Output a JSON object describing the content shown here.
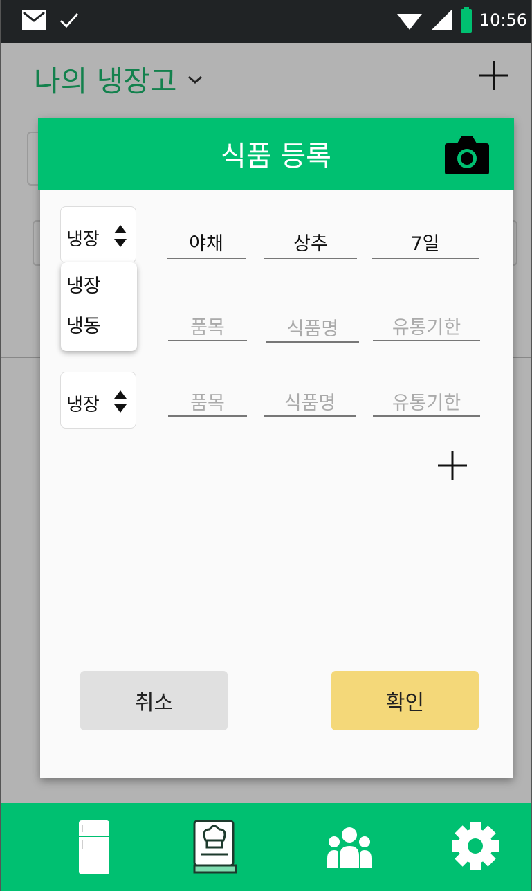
{
  "status_bar": {
    "time": "10:56",
    "icons": [
      "mail-icon",
      "check-icon",
      "wifi-icon",
      "signal-icon",
      "battery-icon"
    ]
  },
  "app": {
    "title": "나의 냉장고",
    "title_color": "#13814d"
  },
  "dialog": {
    "title": "식품 등록",
    "header_color": "#00c071",
    "rows": [
      {
        "storage": "냉장",
        "category": "야채",
        "name": "상추",
        "expiry": "7일"
      },
      {
        "storage": "",
        "category_placeholder": "품목",
        "name_placeholder": "식품명",
        "expiry_placeholder": "유통기한"
      },
      {
        "storage": "냉장",
        "category_placeholder": "품목",
        "name_placeholder": "식품명",
        "expiry_placeholder": "유통기한"
      }
    ],
    "dropdown_options": [
      "냉장",
      "냉동"
    ],
    "cancel_label": "취소",
    "confirm_label": "확인",
    "cancel_color": "#e0e0e0",
    "confirm_color": "#f4d879"
  },
  "bottom_nav": {
    "color": "#00c071",
    "items": [
      "fridge-icon",
      "recipe-book-icon",
      "group-icon",
      "gear-icon"
    ]
  }
}
